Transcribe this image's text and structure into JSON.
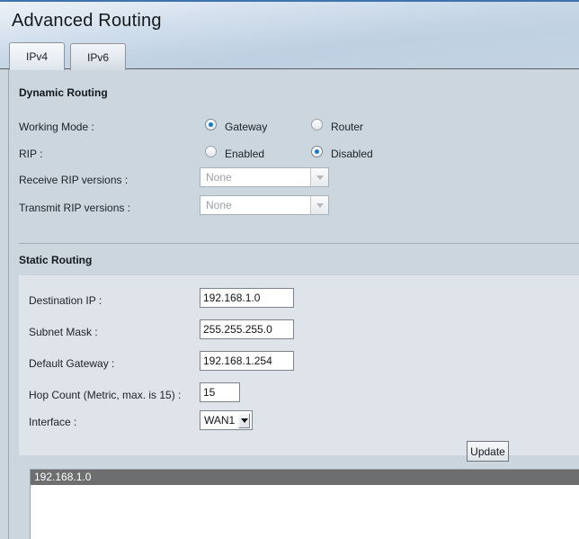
{
  "header": {
    "title": "Advanced Routing"
  },
  "tabs": [
    {
      "label": "IPv4",
      "active": true
    },
    {
      "label": "IPv6",
      "active": false
    }
  ],
  "dynamic_routing": {
    "section_title": "Dynamic Routing",
    "working_mode": {
      "label": "Working Mode :",
      "options": [
        {
          "label": "Gateway",
          "selected": true
        },
        {
          "label": "Router",
          "selected": false
        }
      ]
    },
    "rip": {
      "label": "RIP :",
      "options": [
        {
          "label": "Enabled",
          "selected": false
        },
        {
          "label": "Disabled",
          "selected": true
        }
      ]
    },
    "receive_rip": {
      "label": "Receive RIP versions :",
      "value": "None",
      "disabled": true
    },
    "transmit_rip": {
      "label": "Transmit RIP versions :",
      "value": "None",
      "disabled": true
    }
  },
  "static_routing": {
    "section_title": "Static Routing",
    "destination_ip": {
      "label": "Destination IP :",
      "value": "192.168.1.0"
    },
    "subnet_mask": {
      "label": "Subnet Mask :",
      "value": "255.255.255.0"
    },
    "default_gateway": {
      "label": "Default Gateway :",
      "value": "192.168.1.254"
    },
    "hop_count": {
      "label": "Hop Count (Metric, max. is 15) :",
      "value": "15"
    },
    "interface": {
      "label": "Interface :",
      "value": "WAN1"
    },
    "update_button": "Update",
    "route_list": [
      {
        "label": "192.168.1.0",
        "selected": true
      }
    ]
  },
  "colors": {
    "page_background": "#ccd6de",
    "panel_light": "#dfe4eb",
    "accent_blue": "#1878c8",
    "selection_gray": "#6d6e6f",
    "header_top_line": "#3f73ad"
  }
}
